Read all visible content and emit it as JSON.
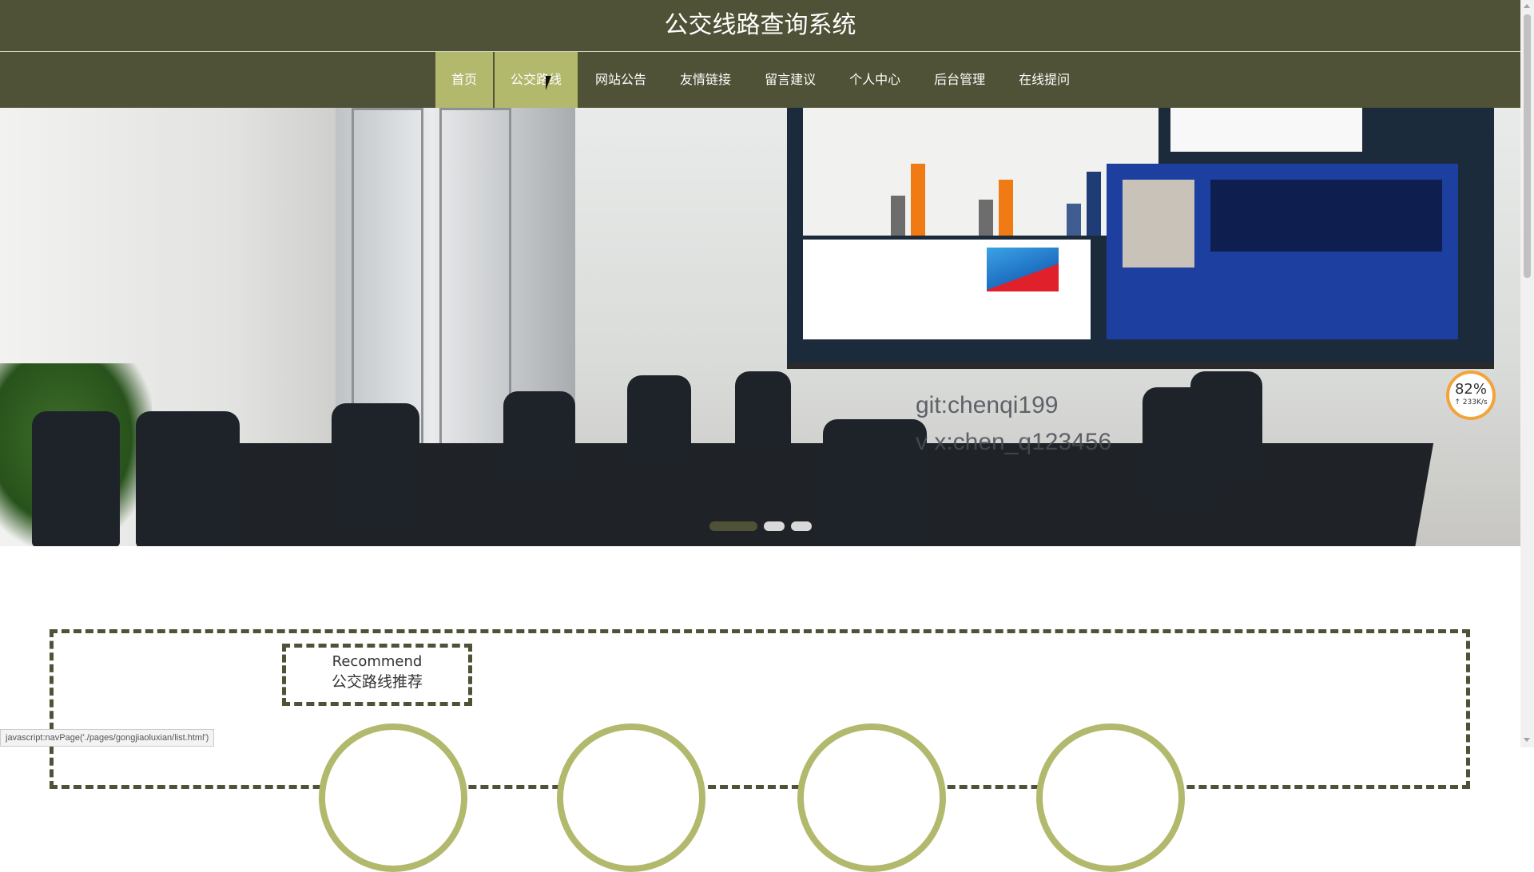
{
  "header": {
    "title": "公交线路查询系统"
  },
  "nav": {
    "items": [
      {
        "label": "首页",
        "state": "active"
      },
      {
        "label": "公交路线",
        "state": "hover"
      },
      {
        "label": "网站公告",
        "state": ""
      },
      {
        "label": "友情链接",
        "state": ""
      },
      {
        "label": "留言建议",
        "state": ""
      },
      {
        "label": "个人中心",
        "state": ""
      },
      {
        "label": "后台管理",
        "state": ""
      },
      {
        "label": "在线提问",
        "state": ""
      }
    ]
  },
  "banner": {
    "overlay_lines": [
      "git:chenqi199",
      "v x:chen_q123456"
    ],
    "slide_count": 3,
    "active_slide": 1
  },
  "speed_widget": {
    "percent": "82%",
    "rate": "↑ 233K/s"
  },
  "recommend": {
    "title_en": "Recommend",
    "title_cn": "公交路线推荐"
  },
  "status_bar": {
    "text": "javascript:navPage('./pages/gongjiaoluxian/list.html')"
  },
  "colors": {
    "primary": "#4f5236",
    "accent": "#b2b86c"
  }
}
